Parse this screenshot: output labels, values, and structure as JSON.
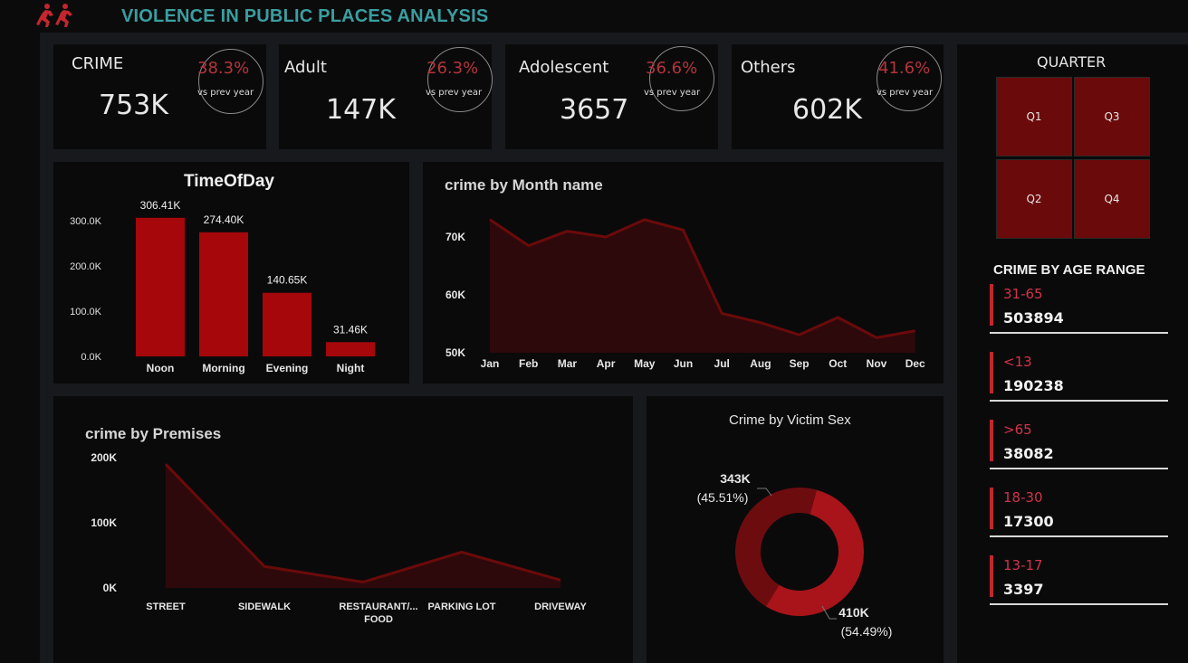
{
  "app": {
    "title": "VIOLENCE IN PUBLIC PLACES ANALYSIS",
    "logo_icon": "running-people-icon"
  },
  "kpis": [
    {
      "label": "CRIME",
      "value": "753K",
      "pct": "38.3%",
      "sub": "vs prev year"
    },
    {
      "label": "Adult",
      "value": "147K",
      "pct": "26.3%",
      "sub": "vs prev year"
    },
    {
      "label": "Adolescent",
      "value": "3657",
      "pct": "36.6%",
      "sub": "vs prev year"
    },
    {
      "label": "Others",
      "value": "602K",
      "pct": "41.6%",
      "sub": "vs prev year"
    }
  ],
  "quarter": {
    "title": "QUARTER",
    "tiles": [
      "Q1",
      "Q3",
      "Q2",
      "Q4"
    ]
  },
  "age_range": {
    "title": "CRIME BY AGE RANGE",
    "items": [
      {
        "label": "31-65",
        "value": "503894"
      },
      {
        "label": "<13",
        "value": "190238"
      },
      {
        "label": ">65",
        "value": "38082"
      },
      {
        "label": "18-30",
        "value": "17300"
      },
      {
        "label": "13-17",
        "value": "3397"
      }
    ]
  },
  "colors": {
    "accent": "#a5070b",
    "area": "#6b0a0a",
    "donut_dark": "#6d0c0f",
    "donut_light": "#a8141a",
    "title_teal": "#3a9ea0"
  },
  "chart_data": [
    {
      "type": "bar",
      "title": "TimeOfDay",
      "categories": [
        "Noon",
        "Morning",
        "Evening",
        "Night"
      ],
      "values": [
        306.41,
        274.4,
        140.65,
        31.46
      ],
      "data_labels": [
        "306.41K",
        "274.40K",
        "140.65K",
        "31.46K"
      ],
      "yticks": [
        "0.0K",
        "100.0K",
        "200.0K",
        "300.0K"
      ],
      "ylim": [
        0,
        320
      ]
    },
    {
      "type": "area",
      "title": "crime by Month name",
      "categories": [
        "Jan",
        "Feb",
        "Mar",
        "Apr",
        "May",
        "Jun",
        "Jul",
        "Aug",
        "Sep",
        "Oct",
        "Nov",
        "Dec"
      ],
      "values": [
        73000,
        68500,
        71000,
        70000,
        73000,
        71200,
        56800,
        55200,
        53100,
        56100,
        52600,
        53800
      ],
      "yticks": [
        "50K",
        "60K",
        "70K"
      ],
      "ylim": [
        50000,
        75000
      ]
    },
    {
      "type": "area",
      "title": "crime by Premises",
      "categories": [
        "STREET",
        "SIDEWALK",
        "RESTAURANT/... FOOD",
        "PARKING LOT",
        "DRIVEWAY"
      ],
      "values": [
        190000,
        33000,
        9000,
        55000,
        12000
      ],
      "yticks": [
        "0K",
        "100K",
        "200K"
      ],
      "ylim": [
        0,
        200000
      ]
    },
    {
      "type": "pie",
      "title": "Crime by Victim Sex",
      "slices": [
        {
          "value": 343,
          "value_label": "343K",
          "pct_label": "(45.51%)",
          "color": "#6d0c0f"
        },
        {
          "value": 410,
          "value_label": "410K",
          "pct_label": "(54.49%)",
          "color": "#a8141a"
        }
      ]
    }
  ]
}
